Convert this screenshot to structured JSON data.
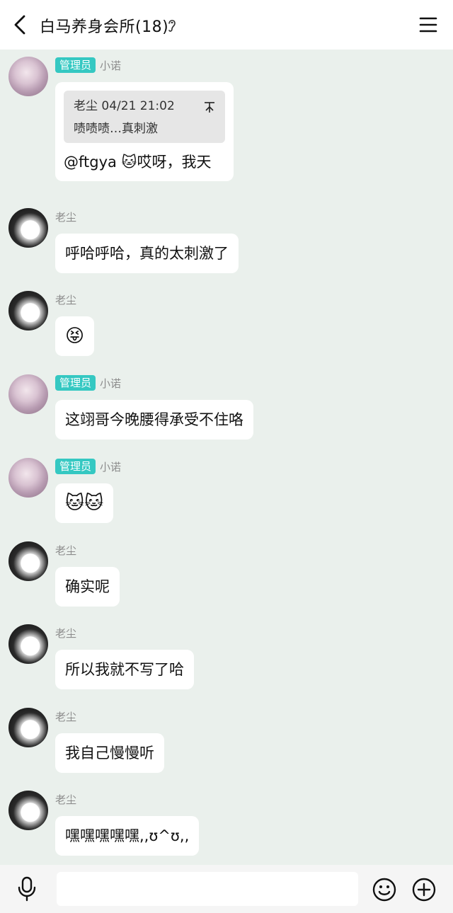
{
  "header": {
    "title": "白马养身会所(18)",
    "back_icon": "chevron-left-icon",
    "ear_icon": "ear-icon",
    "menu_icon": "hamburger-menu-icon"
  },
  "messages": [
    {
      "sender": "小诺",
      "badge": "管理员",
      "quote": {
        "author_time": "老尘 04/21 21:02",
        "text": "啧啧啧…真刺激"
      },
      "text": "@ftgya 🐱哎呀，我天"
    },
    {
      "sender": "老尘",
      "text": "呼哈呼哈，真的太刺激了"
    },
    {
      "sender": "老尘",
      "text": "😝"
    },
    {
      "sender": "小诺",
      "badge": "管理员",
      "text": "这翊哥今晚腰得承受不住咯"
    },
    {
      "sender": "小诺",
      "badge": "管理员",
      "text": "🐱🐱"
    },
    {
      "sender": "老尘",
      "text": "确实呢"
    },
    {
      "sender": "老尘",
      "text": "所以我就不写了哈"
    },
    {
      "sender": "老尘",
      "text": "我自己慢慢听"
    },
    {
      "sender": "老尘",
      "text": "嘿嘿嘿嘿嘿,,ʊ^ʊ,,"
    }
  ],
  "input_bar": {
    "input_value": "",
    "mic_icon": "microphone-icon",
    "emoji_icon": "smiley-icon",
    "plus_icon": "plus-circle-icon"
  },
  "colors": {
    "background": "#eaf0ec",
    "admin_badge": "#35c8c2",
    "bubble": "#ffffff",
    "nickname": "#8c8c8c"
  }
}
